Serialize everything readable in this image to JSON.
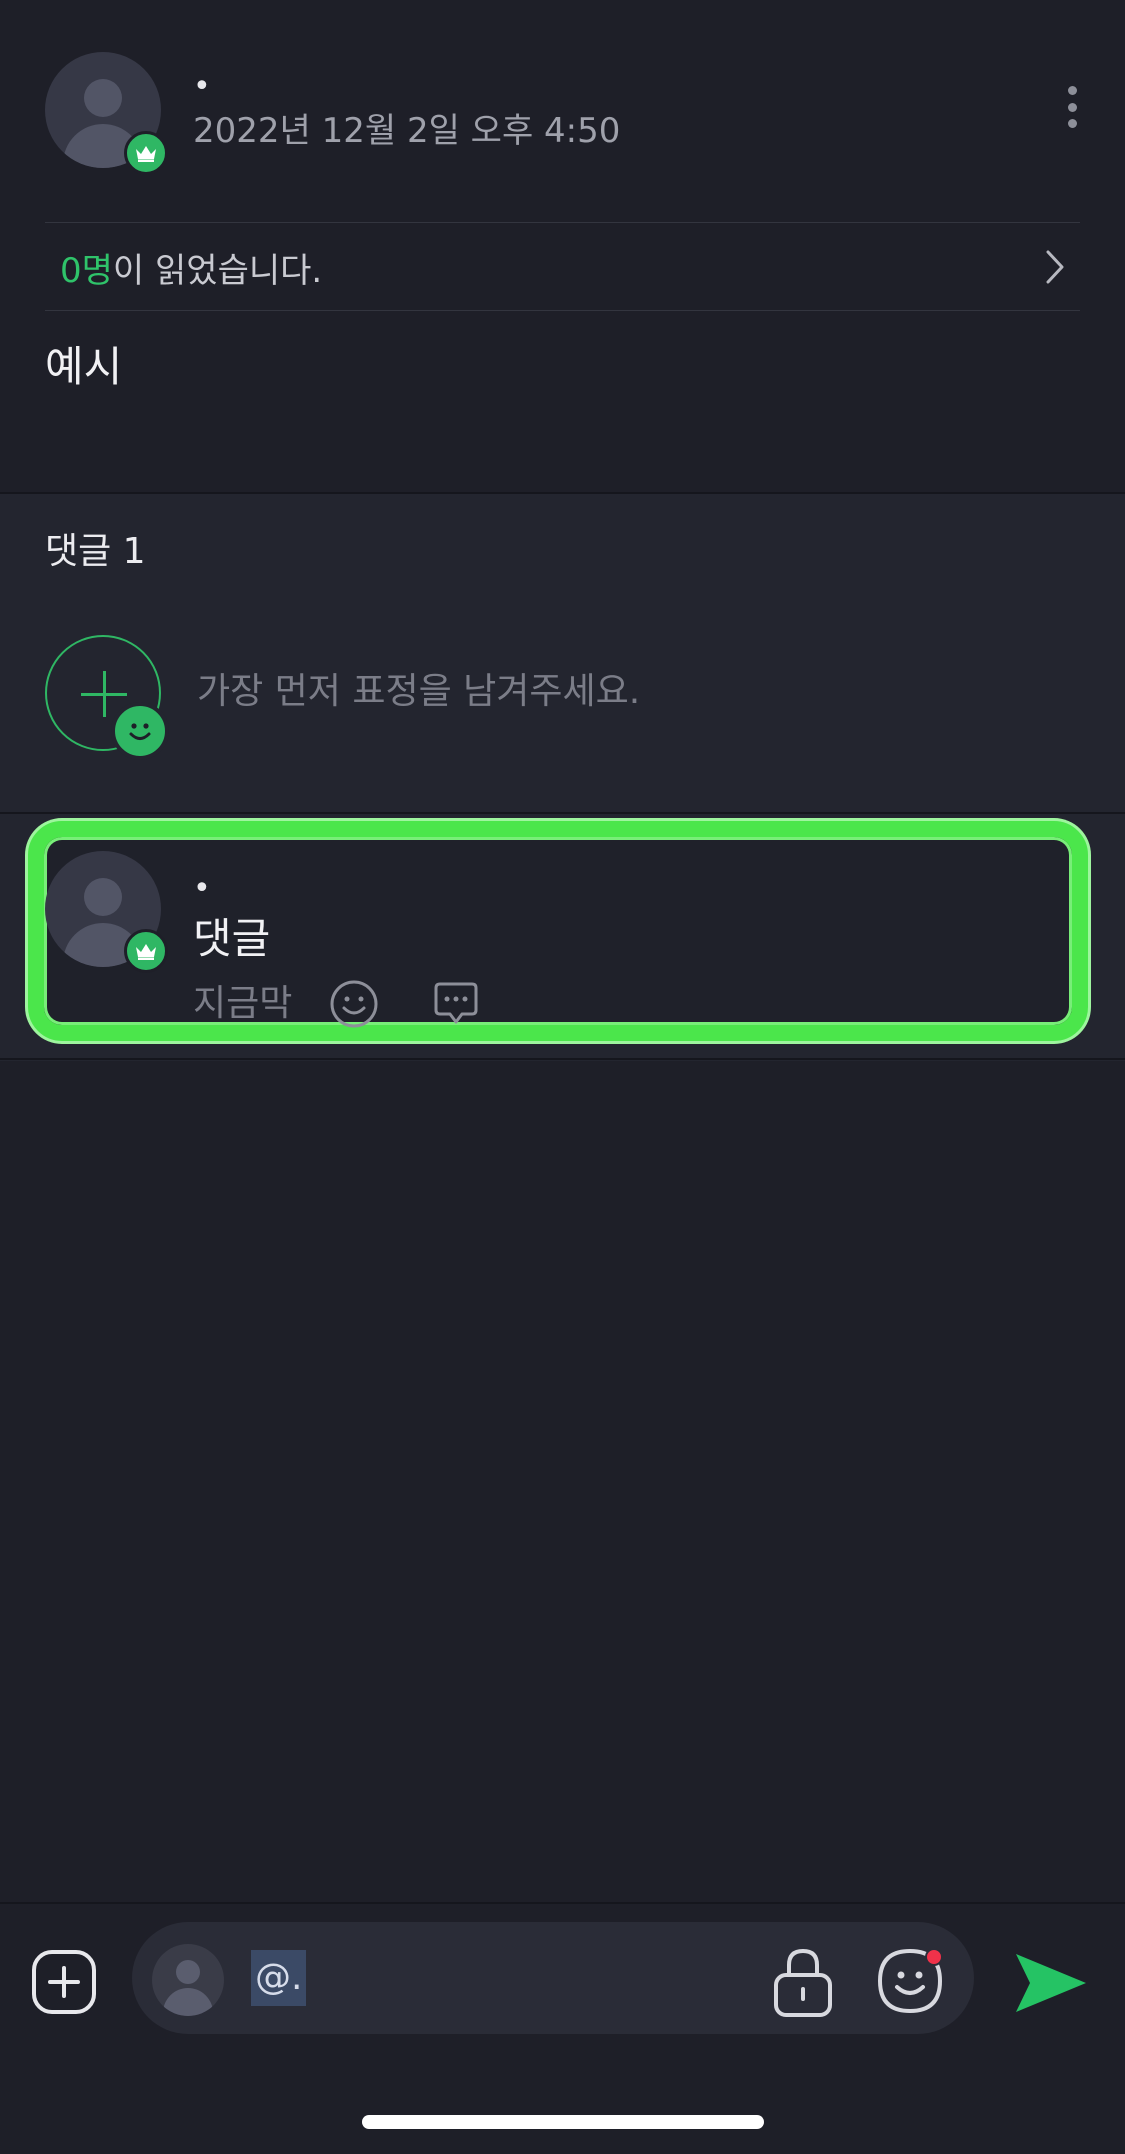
{
  "post": {
    "author": "•",
    "timestamp": "2022년 12월 2일 오후 4:50",
    "read_count": "0명",
    "read_suffix": "이 읽었습니다.",
    "body": "예시"
  },
  "comments": {
    "count_label": "댓글 1",
    "reaction_prompt": "가장 먼저 표정을 남겨주세요.",
    "items": [
      {
        "author": "•",
        "text": "댓글",
        "time": "지금막"
      }
    ]
  },
  "input": {
    "mention": "@."
  },
  "colors": {
    "background": "#1e1f28",
    "accent_green": "#2fb764",
    "highlight_border": "#4be64b",
    "notification_red": "#f0324a"
  },
  "icons": {
    "more": "more-vertical-icon",
    "chevron": "chevron-right-icon",
    "crown": "crown-icon",
    "plus": "plus-icon",
    "smile": "smile-icon",
    "reply": "speech-bubble-icon",
    "attach": "plus-square-icon",
    "lock": "lock-icon",
    "sticker": "sticker-icon",
    "send": "send-icon"
  }
}
